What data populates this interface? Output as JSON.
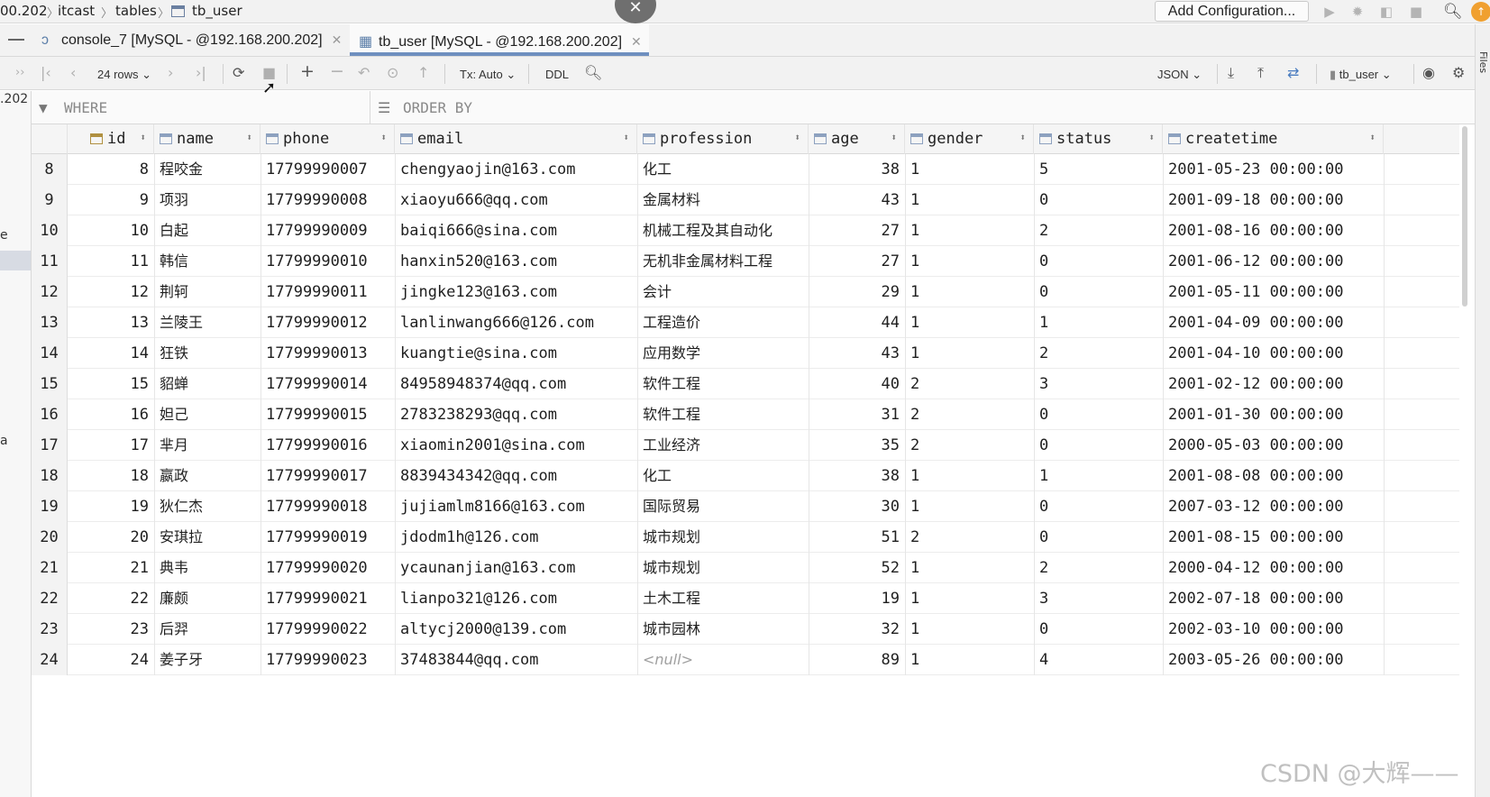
{
  "breadcrumb": [
    "00.202",
    "itcast",
    "tables",
    "tb_user"
  ],
  "run_config": {
    "label": "Add Configuration..."
  },
  "tabs": [
    {
      "label": "console_7 [MySQL - @192.168.200.202]",
      "icon": "console-icon"
    },
    {
      "label": "tb_user [MySQL - @192.168.200.202]",
      "icon": "table-icon"
    }
  ],
  "toolbar": {
    "rows_label": "24 rows",
    "tx_label": "Tx: Auto",
    "ddl_label": "DDL",
    "format_label": "JSON",
    "table_selector": "tb_user"
  },
  "filter": {
    "where": "WHERE",
    "order_by": "ORDER BY"
  },
  "left_fragments": [
    ".202",
    "e",
    "a"
  ],
  "grid": {
    "columns": [
      "id",
      "name",
      "phone",
      "email",
      "profession",
      "age",
      "gender",
      "status",
      "createtime"
    ],
    "rows": [
      [
        "8",
        "8",
        "程咬金",
        "17799990007",
        "chengyaojin@163.com",
        "化工",
        "38",
        "1",
        "5",
        "2001-05-23 00:00:00"
      ],
      [
        "9",
        "9",
        "项羽",
        "17799990008",
        "xiaoyu666@qq.com",
        "金属材料",
        "43",
        "1",
        "0",
        "2001-09-18 00:00:00"
      ],
      [
        "10",
        "10",
        "白起",
        "17799990009",
        "baiqi666@sina.com",
        "机械工程及其自动化",
        "27",
        "1",
        "2",
        "2001-08-16 00:00:00"
      ],
      [
        "11",
        "11",
        "韩信",
        "17799990010",
        "hanxin520@163.com",
        "无机非金属材料工程",
        "27",
        "1",
        "0",
        "2001-06-12 00:00:00"
      ],
      [
        "12",
        "12",
        "荆轲",
        "17799990011",
        "jingke123@163.com",
        "会计",
        "29",
        "1",
        "0",
        "2001-05-11 00:00:00"
      ],
      [
        "13",
        "13",
        "兰陵王",
        "17799990012",
        "lanlinwang666@126.com",
        "工程造价",
        "44",
        "1",
        "1",
        "2001-04-09 00:00:00"
      ],
      [
        "14",
        "14",
        "狂铁",
        "17799990013",
        "kuangtie@sina.com",
        "应用数学",
        "43",
        "1",
        "2",
        "2001-04-10 00:00:00"
      ],
      [
        "15",
        "15",
        "貂蝉",
        "17799990014",
        "84958948374@qq.com",
        "软件工程",
        "40",
        "2",
        "3",
        "2001-02-12 00:00:00"
      ],
      [
        "16",
        "16",
        "妲己",
        "17799990015",
        "2783238293@qq.com",
        "软件工程",
        "31",
        "2",
        "0",
        "2001-01-30 00:00:00"
      ],
      [
        "17",
        "17",
        "芈月",
        "17799990016",
        "xiaomin2001@sina.com",
        "工业经济",
        "35",
        "2",
        "0",
        "2000-05-03 00:00:00"
      ],
      [
        "18",
        "18",
        "嬴政",
        "17799990017",
        "8839434342@qq.com",
        "化工",
        "38",
        "1",
        "1",
        "2001-08-08 00:00:00"
      ],
      [
        "19",
        "19",
        "狄仁杰",
        "17799990018",
        "jujiamlm8166@163.com",
        "国际贸易",
        "30",
        "1",
        "0",
        "2007-03-12 00:00:00"
      ],
      [
        "20",
        "20",
        "安琪拉",
        "17799990019",
        "jdodm1h@126.com",
        "城市规划",
        "51",
        "2",
        "0",
        "2001-08-15 00:00:00"
      ],
      [
        "21",
        "21",
        "典韦",
        "17799990020",
        "ycaunanjian@163.com",
        "城市规划",
        "52",
        "1",
        "2",
        "2000-04-12 00:00:00"
      ],
      [
        "22",
        "22",
        "廉颇",
        "17799990021",
        "lianpo321@126.com",
        "土木工程",
        "19",
        "1",
        "3",
        "2002-07-18 00:00:00"
      ],
      [
        "23",
        "23",
        "后羿",
        "17799990022",
        "altycj2000@139.com",
        "城市园林",
        "32",
        "1",
        "0",
        "2002-03-10 00:00:00"
      ],
      [
        "24",
        "24",
        "姜子牙",
        "17799990023",
        "37483844@qq.com",
        "<null>",
        "89",
        "1",
        "4",
        "2003-05-26 00:00:00"
      ]
    ]
  },
  "side_label": "Files",
  "watermark": "CSDN @大辉——"
}
